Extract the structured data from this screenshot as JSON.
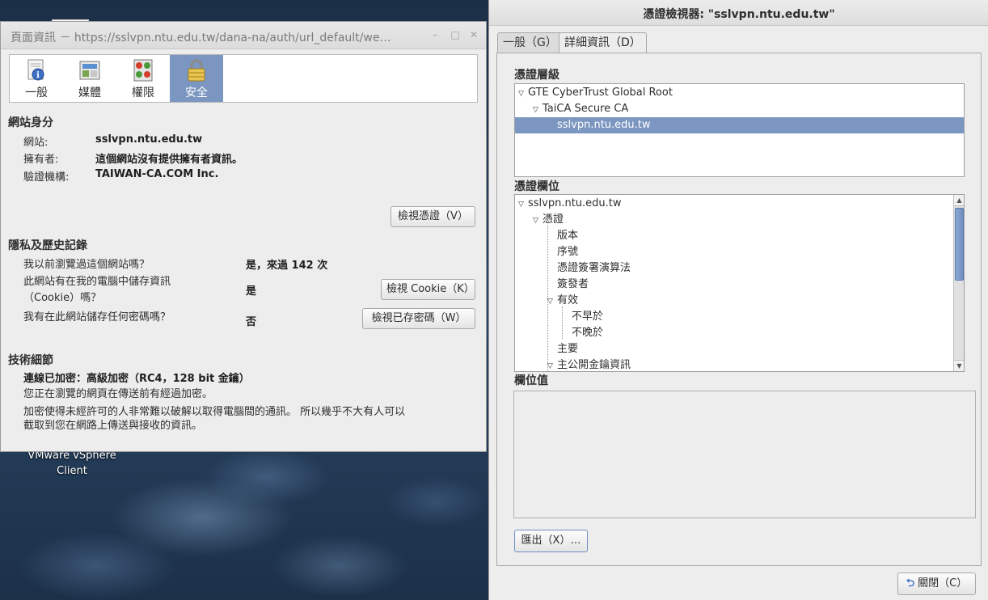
{
  "desktop": {
    "icon_label_line1": "VMware vSphere",
    "icon_label_line2": "Client"
  },
  "page_info": {
    "title": "頁面資訊 － https://sslvpn.ntu.edu.tw/dana-na/auth/url_default/we…",
    "toolbar": [
      {
        "label": "一般",
        "icon": "info-icon"
      },
      {
        "label": "媒體",
        "icon": "media-icon"
      },
      {
        "label": "權限",
        "icon": "permissions-icon"
      },
      {
        "label": "安全",
        "icon": "lock-icon",
        "active": true
      }
    ],
    "identity": {
      "heading": "網站身分",
      "website_label": "網站:",
      "website_value": "sslvpn.ntu.edu.tw",
      "owner_label": "擁有者:",
      "owner_value": "這個網站沒有提供擁有者資訊。",
      "verifier_label": "驗證機構:",
      "verifier_value": "TAIWAN-CA.COM Inc.",
      "view_cert_button": "檢視憑證（V）"
    },
    "privacy": {
      "heading": "隱私及歷史記錄",
      "visited_q": "我以前瀏覽過這個網站嗎？",
      "visited_a": "是，來過 142 次",
      "cookie_q_line1": "此網站有在我的電腦中儲存資訊",
      "cookie_q_line2": "（Cookie）嗎？",
      "cookie_a": "是",
      "cookie_button": "檢視 Cookie（K）",
      "password_q": "我有在此網站儲存任何密碼嗎？",
      "password_a": "否",
      "password_button": "檢視已存密碼（W）"
    },
    "technical": {
      "heading": "技術細節",
      "encryption": "連線已加密：高級加密（RC4，128 bit 金鑰）",
      "line1": "您正在瀏覽的網頁在傳送前有經過加密。",
      "line2": "加密使得未經許可的人非常難以破解以取得電腦間的通訊。 所以幾乎不大有人可以",
      "line3": "截取到您在網路上傳送與接收的資訊。"
    }
  },
  "cert_viewer": {
    "title": "憑證檢視器: \"sslvpn.ntu.edu.tw\"",
    "tabs": [
      {
        "label": "一般（G）",
        "active": false
      },
      {
        "label": "詳細資訊（D）",
        "active": true
      }
    ],
    "hierarchy_heading": "憑證層級",
    "hierarchy": [
      {
        "label": "GTE CyberTrust Global Root",
        "expanded": true
      },
      {
        "label": "TaiCA Secure CA",
        "expanded": true
      },
      {
        "label": "sslvpn.ntu.edu.tw",
        "selected": true
      }
    ],
    "fields_heading": "憑證欄位",
    "fields": [
      {
        "label": "sslvpn.ntu.edu.tw",
        "expanded": true
      },
      {
        "label": "憑證",
        "expanded": true
      },
      {
        "label": "版本"
      },
      {
        "label": "序號"
      },
      {
        "label": "憑證簽署演算法"
      },
      {
        "label": "簽發者"
      },
      {
        "label": "有效",
        "expanded": true
      },
      {
        "label": "不早於"
      },
      {
        "label": "不晚於"
      },
      {
        "label": "主要"
      },
      {
        "label": "主公開金鑰資訊",
        "expanded": true
      }
    ],
    "value_heading": "欄位值",
    "export_button": "匯出（X）…",
    "close_button": "關閉（C）"
  }
}
